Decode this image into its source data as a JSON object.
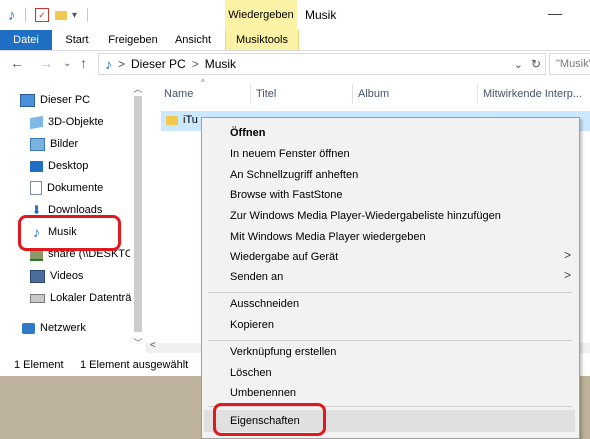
{
  "window": {
    "title": "Musik",
    "context_tab_header": "Wiedergeben",
    "minimize_glyph": "—"
  },
  "ribbon": {
    "tabs": [
      {
        "label": "Datei"
      },
      {
        "label": "Start"
      },
      {
        "label": "Freigeben"
      },
      {
        "label": "Ansicht"
      },
      {
        "label": "Musiktools"
      }
    ]
  },
  "address": {
    "segments": [
      "Dieser PC",
      "Musik"
    ],
    "search_placeholder": "\"Musik\" durchsuchen",
    "path_separator": ">",
    "dropdown_glyph": "⌄",
    "refresh_glyph": "↻"
  },
  "sidebar": {
    "items": [
      {
        "label": "Dieser PC",
        "icon": "computer-icon"
      },
      {
        "label": "3D-Objekte",
        "icon": "cube-icon"
      },
      {
        "label": "Bilder",
        "icon": "pictures-icon"
      },
      {
        "label": "Desktop",
        "icon": "desktop-icon"
      },
      {
        "label": "Dokumente",
        "icon": "documents-icon"
      },
      {
        "label": "Downloads",
        "icon": "download-icon"
      },
      {
        "label": "Musik",
        "icon": "music-icon"
      },
      {
        "label": "share (\\\\DESKTOP-",
        "icon": "network-drive-icon"
      },
      {
        "label": "Videos",
        "icon": "videos-icon"
      },
      {
        "label": "Lokaler Datenträ",
        "icon": "drive-icon"
      },
      {
        "label": "Netzwerk",
        "icon": "network-icon"
      }
    ]
  },
  "columns": [
    "Name",
    "Titel",
    "Album",
    "Mitwirkende Interp..."
  ],
  "files": [
    {
      "name": "iTu"
    }
  ],
  "status": {
    "count": "1 Element",
    "selected": "1 Element ausgewählt"
  },
  "context_menu": {
    "groups": [
      [
        {
          "label": "Öffnen",
          "bold": true
        },
        {
          "label": "In neuem Fenster öffnen"
        },
        {
          "label": "An Schnellzugriff anheften"
        },
        {
          "label": "Browse with FastStone"
        },
        {
          "label": "Zur Windows Media Player-Wiedergabeliste hinzufügen"
        },
        {
          "label": "Mit Windows Media Player wiedergeben"
        },
        {
          "label": "Wiedergabe auf Gerät",
          "submenu": true
        },
        {
          "label": "Senden an",
          "submenu": true
        }
      ],
      [
        {
          "label": "Ausschneiden"
        },
        {
          "label": "Kopieren"
        }
      ],
      [
        {
          "label": "Verknüpfung erstellen"
        },
        {
          "label": "Löschen"
        },
        {
          "label": "Umbenennen"
        }
      ],
      [
        {
          "label": "Eigenschaften"
        }
      ]
    ]
  },
  "colors": {
    "accent": "#1f6fc4",
    "context_tab": "#fcf2a6",
    "highlight_red": "#e0191d",
    "selection": "#cce8ff"
  }
}
